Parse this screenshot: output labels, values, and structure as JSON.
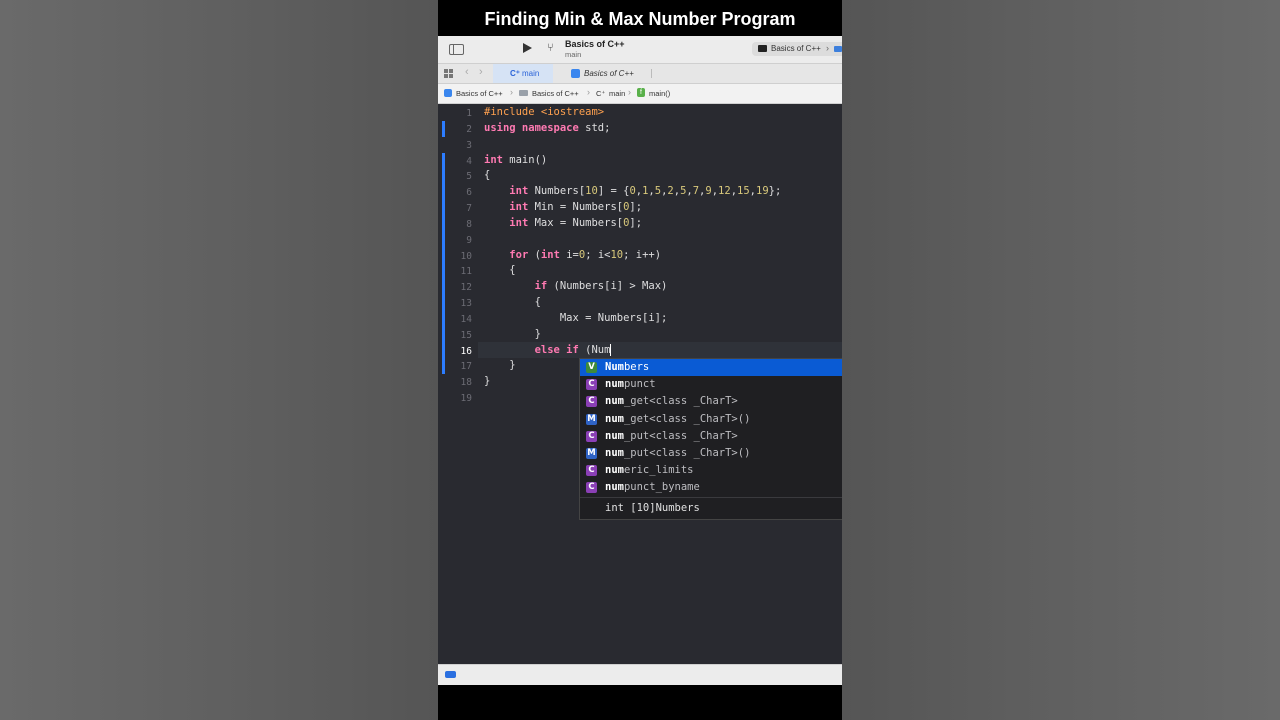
{
  "video": {
    "title": "Finding Min & Max Number Program"
  },
  "toolbar": {
    "scheme_name": "Basics of C++",
    "scheme_branch": "main",
    "destination_label": "Basics of C++",
    "run_icon": "play-icon",
    "branch_icon": "branch-icon"
  },
  "tabs": [
    {
      "icon": "C⁺",
      "label": "main",
      "active": true
    },
    {
      "label": "Basics of C++",
      "active": false
    }
  ],
  "jumpbar": {
    "project": "Basics of C++",
    "folder": "Basics of C++",
    "file_icon": "C⁺",
    "file": "main",
    "func_icon": "f",
    "function": "main()"
  },
  "editor": {
    "current_line": 16,
    "lines": [
      {
        "n": "1"
      },
      {
        "n": "2"
      },
      {
        "n": "3"
      },
      {
        "n": "4"
      },
      {
        "n": "5"
      },
      {
        "n": "6"
      },
      {
        "n": "7"
      },
      {
        "n": "8"
      },
      {
        "n": "9"
      },
      {
        "n": "10"
      },
      {
        "n": "11"
      },
      {
        "n": "12"
      },
      {
        "n": "13"
      },
      {
        "n": "14"
      },
      {
        "n": "15"
      },
      {
        "n": "16"
      },
      {
        "n": "17"
      },
      {
        "n": "18"
      },
      {
        "n": "19"
      }
    ],
    "tokens": {
      "l1_pp": "#include <iostream>",
      "l2_kw": "using namespace",
      "l2_rest": " std;",
      "l4_kw": "int",
      "l4_rest": " main()",
      "l5": "{",
      "l6_kw": "int",
      "l6_a": " Numbers[",
      "l6_n1": "10",
      "l6_b": "] = {",
      "l6_vals": [
        "0",
        "1",
        "5",
        "2",
        "5",
        "7",
        "9",
        "12",
        "15",
        "19"
      ],
      "l6_end": "};",
      "l7_kw": "int",
      "l7_a": " Min = Numbers[",
      "l7_n": "0",
      "l7_b": "];",
      "l8_kw": "int",
      "l8_a": " Max = Numbers[",
      "l8_n": "0",
      "l8_b": "];",
      "l10_kw": "for",
      "l10_a": " (",
      "l10_kw2": "int",
      "l10_b": " i=",
      "l10_n1": "0",
      "l10_c": "; i<",
      "l10_n2": "10",
      "l10_d": "; i++)",
      "l11": "{",
      "l12_kw": "if",
      "l12_rest": " (Numbers[i] > Max)",
      "l13": "{",
      "l14": "Max = Numbers[i];",
      "l15": "}",
      "l16_kw": "else if",
      "l16_rest": " (Num",
      "l17": "}",
      "l18": "}"
    }
  },
  "autocomplete": {
    "items": [
      {
        "badge": "V",
        "match": "Num",
        "rest": "bers",
        "selected": true
      },
      {
        "badge": "C",
        "match": "num",
        "rest": "punct"
      },
      {
        "badge": "C",
        "match": "num",
        "rest": "_get<class _CharT>"
      },
      {
        "badge": "M",
        "match": "num",
        "rest": "_get<class _CharT>()"
      },
      {
        "badge": "C",
        "match": "num",
        "rest": "_put<class _CharT>"
      },
      {
        "badge": "M",
        "match": "num",
        "rest": "_put<class _CharT>()"
      },
      {
        "badge": "C",
        "match": "num",
        "rest": "eric_limits"
      },
      {
        "badge": "C",
        "match": "num",
        "rest": "punct_byname"
      }
    ],
    "detail": "int [10]Numbers"
  },
  "colors": {
    "keyword": "#ff7ab2",
    "preprocessor": "#ffa14f",
    "number": "#d9c97c",
    "selection": "#0a5bd4",
    "change_bar": "#2d7dff"
  }
}
